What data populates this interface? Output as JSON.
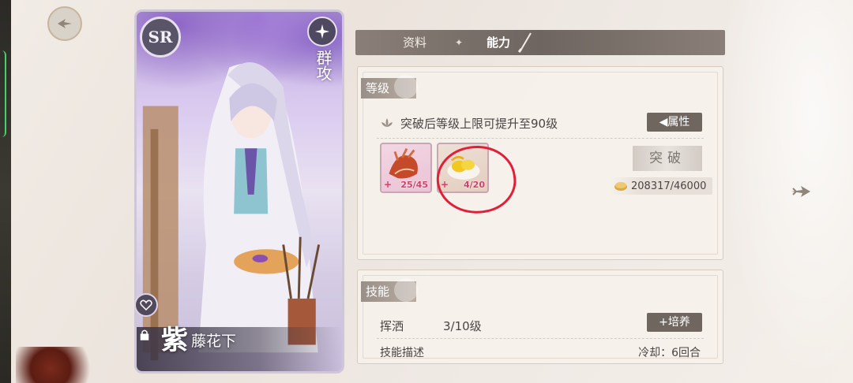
{
  "colors": {
    "accent_dark": "#6f6660",
    "highlight_red": "#e0203a",
    "count_pink": "#d1426a",
    "panel_bg": "#f6f1ec"
  },
  "card": {
    "rarity": "SR",
    "attack_type": "群攻",
    "name_main": "紫",
    "name_sub": "藤花下"
  },
  "tabs": {
    "profile": "资料",
    "separator": "✦",
    "ability": "能力"
  },
  "level_section": {
    "title": "等级",
    "breakthrough_info": "突破后等级上限可提升至90级",
    "attributes_button": "属性",
    "materials": [
      {
        "icon": "shell-icon",
        "count": "25/45"
      },
      {
        "icon": "lemon-tart-icon",
        "count": "4/20"
      }
    ],
    "break_button": "突破",
    "coin_cost": "208317/46000"
  },
  "skill_section": {
    "title": "技能",
    "skill_name": "挥洒",
    "skill_level": "3/10级",
    "train_button": "培养",
    "description_label": "技能描述",
    "cooldown": "冷却：6回合"
  },
  "icons": {
    "back": "back-arrow-icon",
    "next": "next-arrow-icon",
    "lock": "lock-icon",
    "favorite": "heart-icon",
    "pen": "pen-icon",
    "lotus": "lotus-icon",
    "coin": "coin-icon"
  }
}
